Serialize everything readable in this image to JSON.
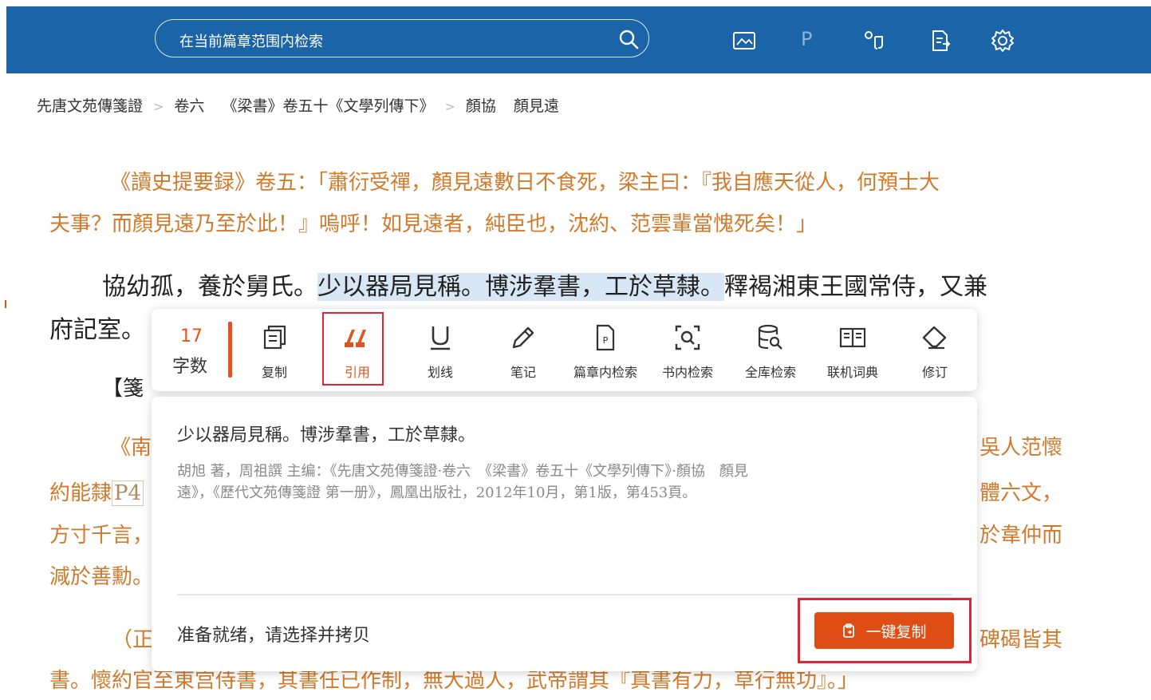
{
  "search": {
    "placeholder": "在当前篇章范围内检索"
  },
  "topbar_icons": [
    "image-icon",
    "p-icon",
    "key-icon",
    "export-icon",
    "gear-icon"
  ],
  "topbar_p_glyph": "P",
  "breadcrumb": {
    "items": [
      "先唐文苑傳箋證",
      "卷六",
      "《梁書》卷五十《文學列傳下》",
      "顏協",
      "顏見遠"
    ]
  },
  "text": {
    "orange_line1": "《讀史提要録》卷五：「蕭衍受禪，顏見遠數日不食死，梁主曰：『我自應天從人，何預士大",
    "orange_line2": "夫事？而顏見遠乃至於此！』嗚呼！如見遠者，純臣也，沈約、范雲輩當愧死矣！」",
    "main_before": "協幼孤，養於舅氏。",
    "main_highlight": "少以器局見稱。博涉羣書，工於草隸。",
    "main_after": "釋褐湘東王國常侍，又兼",
    "main_line2": "府記室。",
    "frag_jian": "【箋",
    "frag_nan": "《南",
    "frag_yue": "約能隸",
    "frag_p4": "P4",
    "frag_fang": "方寸千言，",
    "frag_jian2": "減於善勳。",
    "frag_zheng": "（正",
    "right_1": "吳人范懷",
    "right_2": "體六文，",
    "right_3": "於韋仲而",
    "right_4": "碑碣皆其",
    "bottom_line": "書。懷約官至東宫侍書，其書任已作制，無大過人，武帝謂其『真書有力，草行無功』。」"
  },
  "toolbar": {
    "word_count_value": "17",
    "word_count_label": "字数",
    "buttons": [
      {
        "label": "复制",
        "icon": "copy-icon"
      },
      {
        "label": "引用",
        "icon": "quote-icon",
        "active": true
      },
      {
        "label": "划线",
        "icon": "underline-icon"
      },
      {
        "label": "笔记",
        "icon": "pencil-icon"
      },
      {
        "label": "篇章内检索",
        "icon": "chapter-search-icon"
      },
      {
        "label": "书内检索",
        "icon": "book-search-icon"
      },
      {
        "label": "全库检索",
        "icon": "database-search-icon"
      },
      {
        "label": "联机词典",
        "icon": "dictionary-icon"
      },
      {
        "label": "修订",
        "icon": "eraser-icon"
      }
    ]
  },
  "citation": {
    "quote": "少以器局見稱。博涉羣書，工於草隸。",
    "source_line1": "胡旭 著，周祖譔 主编：《先唐文苑傳箋證·卷六　《梁書》卷五十《文學列傳下》·顏協　顏見",
    "source_line2": "遠》，《歷代文苑傳箋證 第一册》，鳳凰出版社，2012年10月，第1版，第453頁。",
    "status": "准备就绪，请选择并拷贝",
    "copy_button": "一键复制"
  },
  "colors": {
    "topbar": "#1b64a8",
    "accent": "#de4d14",
    "orange_text": "#d27a2c",
    "highlight": "#d7e7f6",
    "annotation_box": "#e2243a"
  }
}
